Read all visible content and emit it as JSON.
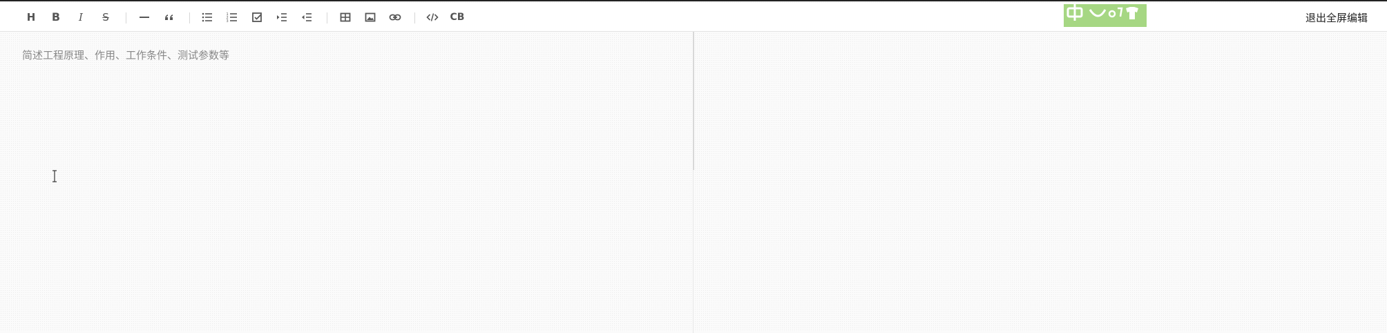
{
  "toolbar": {
    "buttons": [
      {
        "name": "heading-button",
        "icon": "heading-icon",
        "glyph": "H"
      },
      {
        "name": "bold-button",
        "icon": "bold-icon",
        "glyph": "B"
      },
      {
        "name": "italic-button",
        "icon": "italic-icon",
        "glyph": "I"
      },
      {
        "name": "strikethrough-button",
        "icon": "strikethrough-icon",
        "glyph": "S"
      },
      {
        "name": "horizontal-rule-button",
        "icon": "horizontal-rule-icon"
      },
      {
        "name": "quote-button",
        "icon": "quote-icon"
      },
      {
        "name": "bullet-list-button",
        "icon": "bullet-list-icon"
      },
      {
        "name": "ordered-list-button",
        "icon": "ordered-list-icon"
      },
      {
        "name": "task-list-button",
        "icon": "checkbox-icon"
      },
      {
        "name": "indent-button",
        "icon": "indent-icon"
      },
      {
        "name": "outdent-button",
        "icon": "outdent-icon"
      },
      {
        "name": "table-button",
        "icon": "table-icon"
      },
      {
        "name": "image-button",
        "icon": "image-icon"
      },
      {
        "name": "link-button",
        "icon": "link-icon"
      },
      {
        "name": "code-button",
        "icon": "code-icon"
      },
      {
        "name": "code-block-button",
        "icon": "code-block-icon",
        "glyph": "CB"
      }
    ],
    "exit_fullscreen_label": "退出全屏编辑"
  },
  "logo": {
    "icon": "logo-icon",
    "color": "#a6d783"
  },
  "editor": {
    "placeholder": "简述工程原理、作用、工作条件、测试参数等",
    "value": ""
  },
  "colors": {
    "toolbar_bg": "#ffffff",
    "icon": "#555555",
    "divider": "#e3e3e3"
  }
}
